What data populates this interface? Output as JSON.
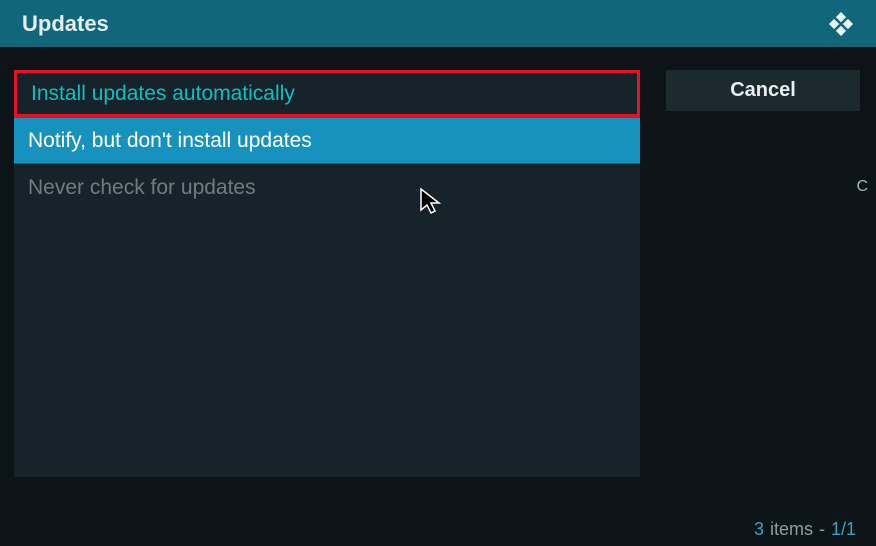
{
  "header": {
    "title": "Updates"
  },
  "options": [
    {
      "label": "Install updates automatically",
      "state": "selected"
    },
    {
      "label": "Notify, but don't install updates",
      "state": "hover"
    },
    {
      "label": "Never check for updates",
      "state": "normal"
    }
  ],
  "side": {
    "cancel_label": "Cancel"
  },
  "footer": {
    "count": "3",
    "items_word": "items",
    "sep": "-",
    "page": "1/1"
  },
  "edge": {
    "char": "C"
  }
}
